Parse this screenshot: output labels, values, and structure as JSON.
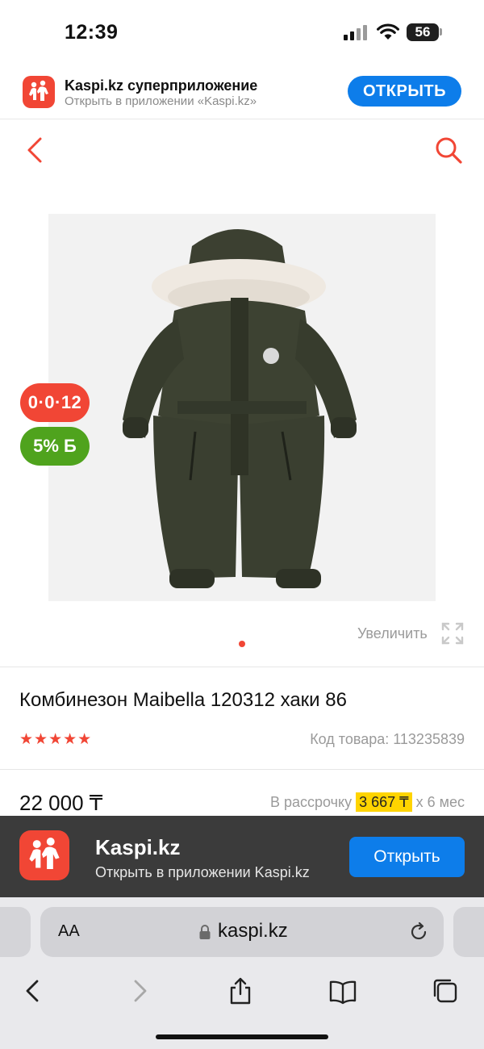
{
  "status": {
    "time": "12:39",
    "battery": "56"
  },
  "app_banner": {
    "title": "Kaspi.kz суперприложение",
    "subtitle": "Открыть в приложении «Kaspi.kz»",
    "open_label": "ОТКРЫТЬ"
  },
  "gallery": {
    "badge_installment": "0·0·12",
    "badge_bonus": "5% Б",
    "zoom_label": "Увеличить",
    "current_image": 1
  },
  "product": {
    "title": "Комбинезон Maibella 120312 хаки 86",
    "rating_stars": 5,
    "stars_text": "★★★★★",
    "code": "Код товара: 113235839",
    "price": "22 000 ₸",
    "installment_prefix": "В рассрочку",
    "installment_amount": "3 667 ₸",
    "installment_suffix": "x 6 мес"
  },
  "kaspi_bar": {
    "title": "Kaspi.kz",
    "subtitle": "Открыть в приложении Kaspi.kz",
    "open_label": "Открыть"
  },
  "browser": {
    "aa_label": "AA",
    "url": "kaspi.kz"
  },
  "colors": {
    "brand_red": "#f14635",
    "brand_blue": "#0d7dea",
    "bonus_green": "#4fa31d",
    "installment_yellow": "#ffd400"
  },
  "icons": [
    "back-chevron-icon",
    "search-icon",
    "zoom-expand-icon",
    "kaspi-logo-icon",
    "lock-icon",
    "reload-icon",
    "back-icon",
    "forward-icon",
    "share-icon",
    "bookmarks-icon",
    "tabs-icon"
  ]
}
